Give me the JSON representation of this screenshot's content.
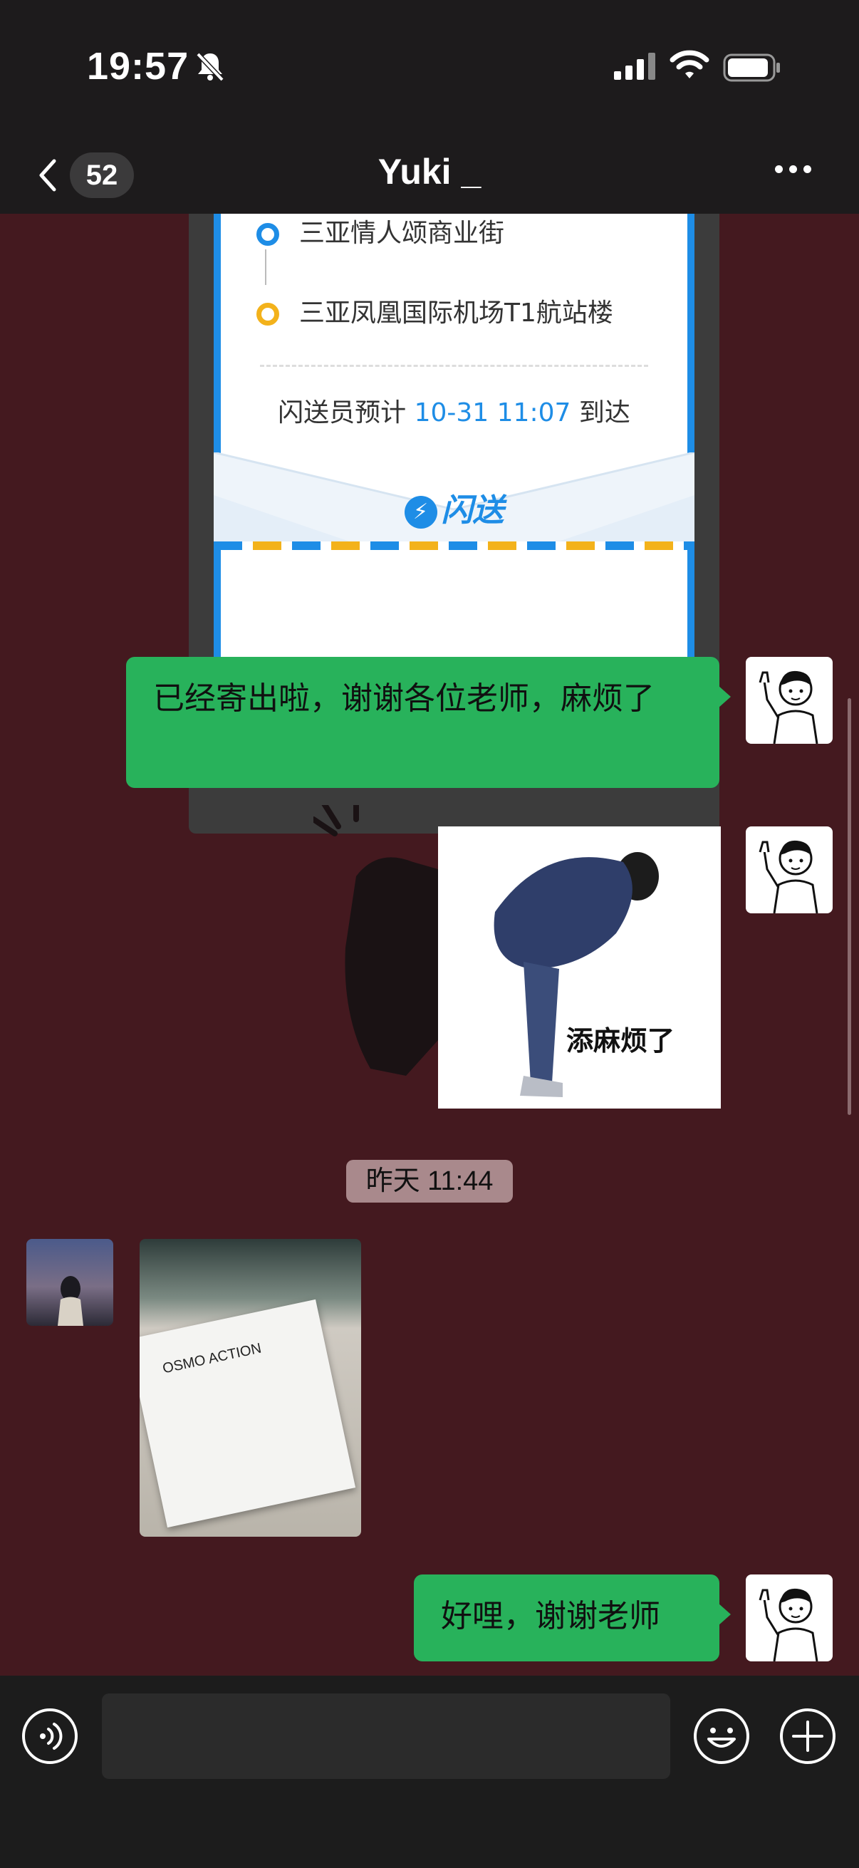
{
  "status_bar": {
    "time": "19:57"
  },
  "header": {
    "back_badge": "52",
    "title": "Yuki _"
  },
  "messages": {
    "shipping_card": {
      "origin": "三亚情人颂商业街",
      "destination": "三亚凤凰国际机场T1航站楼",
      "eta_prefix": "闪送员预计",
      "eta_time": "10-31 11:07",
      "eta_suffix": "到达",
      "brand": "闪送"
    },
    "msg1": "已经寄出啦，谢谢各位老师，麻烦了",
    "sticker_caption": "添麻烦了",
    "timestamp": "昨天 11:44",
    "msg2": "好哩，谢谢老师"
  },
  "photo_text": "OSMO ACTION",
  "input": {
    "placeholder": ""
  }
}
